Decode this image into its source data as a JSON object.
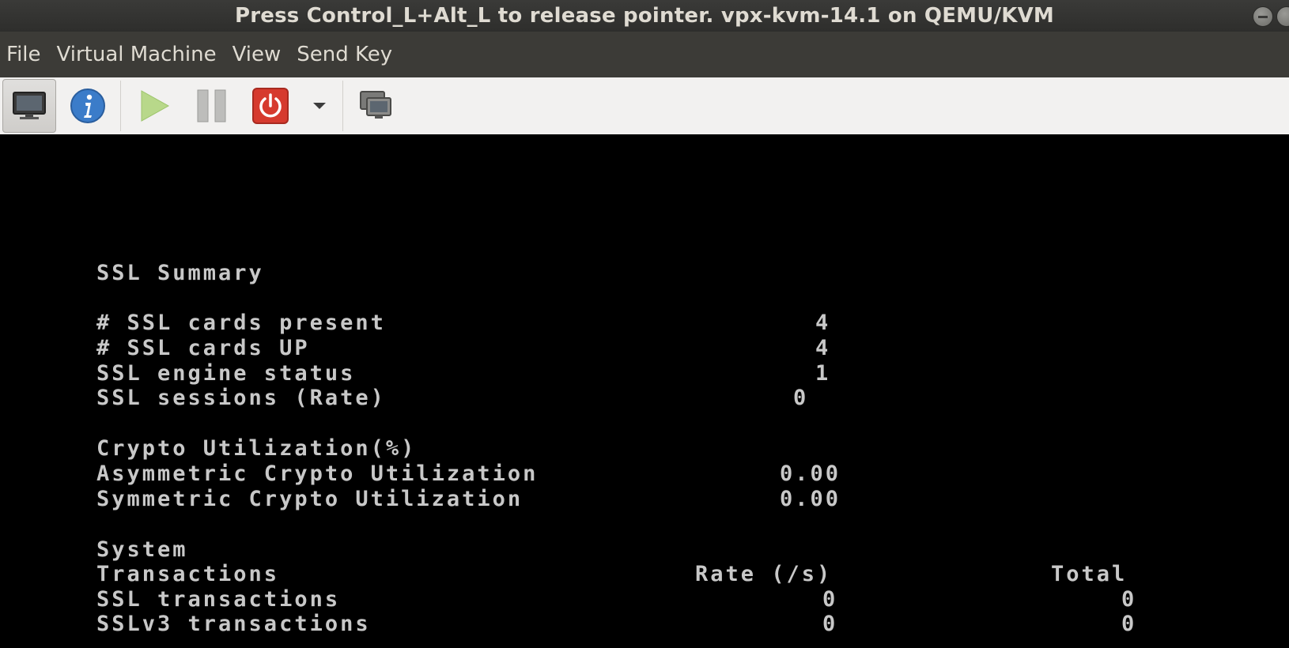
{
  "window": {
    "title": "Press Control_L+Alt_L to release pointer. vpx-kvm-14.1 on QEMU/KVM"
  },
  "menu": {
    "file": "File",
    "virtual_machine": "Virtual Machine",
    "view": "View",
    "send_key": "Send Key"
  },
  "toolbar": {
    "icons": [
      "monitor-icon",
      "info-icon",
      "play-icon",
      "pause-icon",
      "power-icon",
      "chevron-down-icon",
      "screenshot-icon"
    ]
  },
  "console": {
    "ssl_summary": {
      "title": "SSL Summary",
      "cards_present_label": "# SSL cards present",
      "cards_present_value": "4",
      "cards_up_label": "# SSL cards UP",
      "cards_up_value": "4",
      "engine_status_label": "SSL engine status",
      "engine_status_value": "1",
      "sessions_label": "SSL sessions (Rate)",
      "sessions_value": "0"
    },
    "crypto": {
      "title": "Crypto Utilization(%)",
      "asym_label": "Asymmetric Crypto Utilization",
      "asym_value": "0.00",
      "sym_label": "Symmetric Crypto Utilization",
      "sym_value": "0.00"
    },
    "system": {
      "title": "System",
      "transactions_label": "Transactions",
      "rate_header": "Rate (/s)",
      "total_header": "Total",
      "rows": [
        {
          "label": "SSL transactions",
          "rate": "0",
          "total": "0"
        },
        {
          "label": "SSLv3 transactions",
          "rate": "0",
          "total": "0"
        }
      ]
    }
  }
}
